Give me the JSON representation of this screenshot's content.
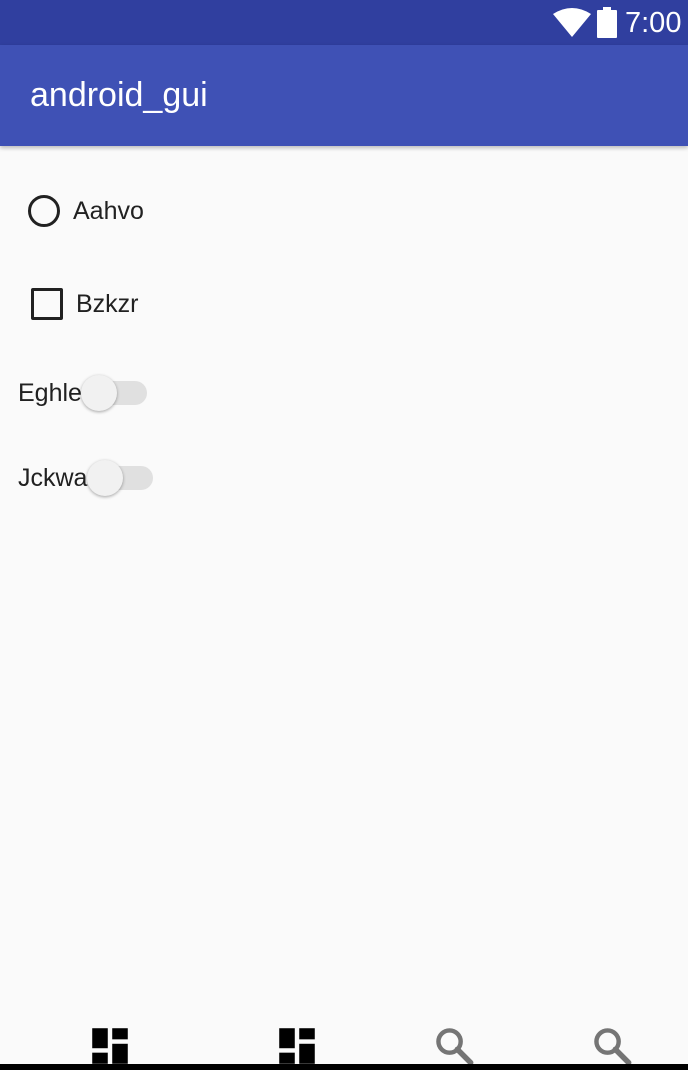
{
  "status_bar": {
    "time": "7:00",
    "icons": [
      "wifi-icon",
      "battery-icon"
    ],
    "color": "#303f9f"
  },
  "app_bar": {
    "title": "android_gui",
    "color": "#3f51b5"
  },
  "controls": {
    "radio": {
      "label": "Aahvo",
      "checked": false
    },
    "checkbox": {
      "label": "Bzkzr",
      "checked": false
    },
    "switch_1": {
      "label": "Eghle",
      "on": false
    },
    "switch_2": {
      "label": "Jckwa",
      "on": false
    }
  },
  "bottom_nav": {
    "items": [
      {
        "icon": "dashboard-icon"
      },
      {
        "icon": "dashboard-icon"
      },
      {
        "icon": "search-icon"
      },
      {
        "icon": "search-icon"
      }
    ]
  }
}
